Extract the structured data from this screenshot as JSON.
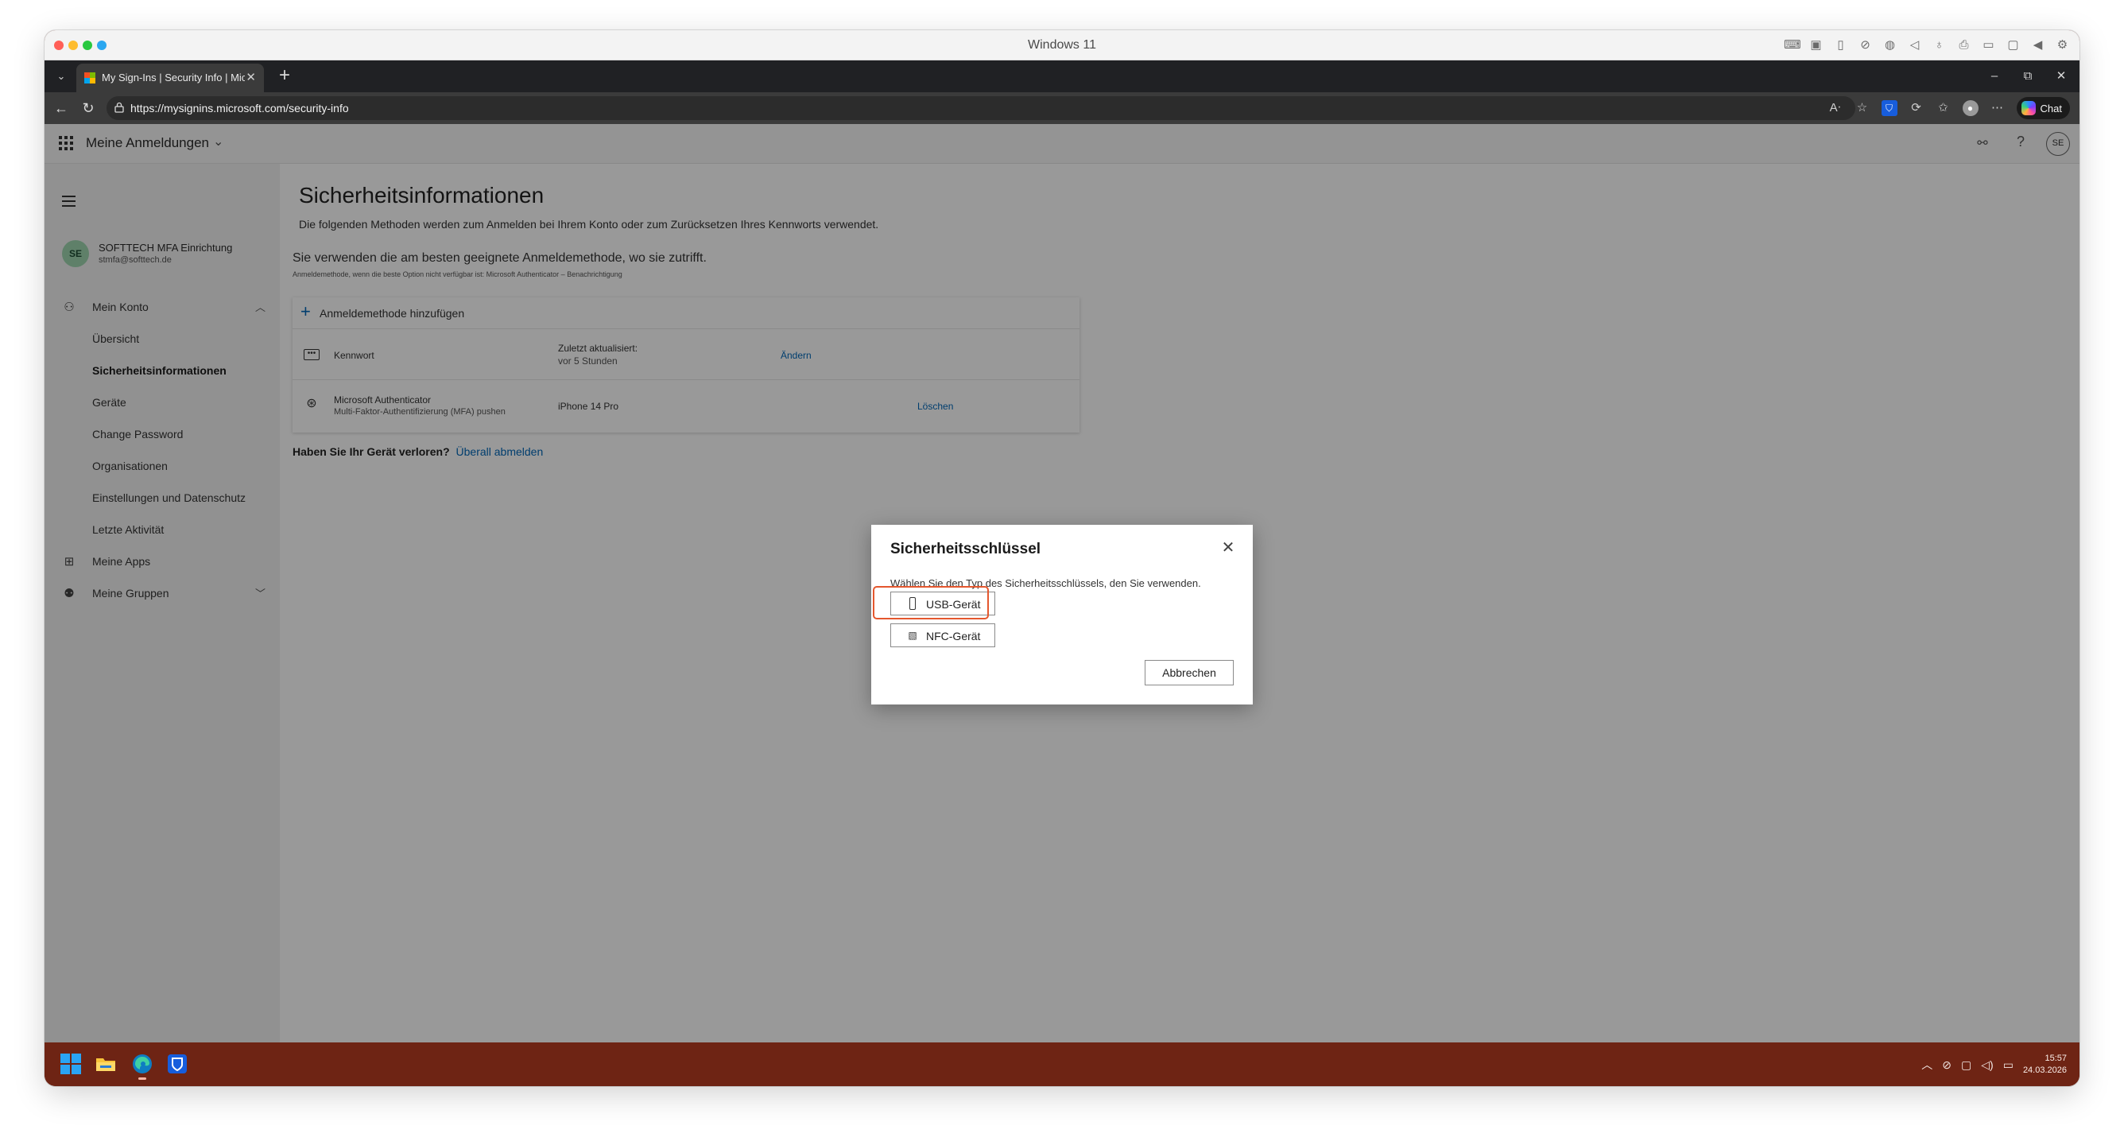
{
  "mac": {
    "window_title": "Windows 11",
    "traffic_colors": [
      "#ff5f57",
      "#febc2e",
      "#28c840",
      "#2aa7f0"
    ],
    "toolbar_icons": [
      "keyboard-icon",
      "cpu-icon",
      "usb-icon",
      "camera-off-icon",
      "globe-icon",
      "speaker-icon",
      "microphone-icon",
      "printer-icon",
      "video-icon",
      "display-icon",
      "play-icon",
      "settings-icon"
    ]
  },
  "browser": {
    "tab_title": "My Sign-Ins | Security Info | Microsoft",
    "url": "https://mysignins.microsoft.com/security-info",
    "chat_label": "Chat"
  },
  "app": {
    "title": "Meine Anmeldungen",
    "avatar_initials": "SE"
  },
  "sidebar": {
    "profile_initials": "SE",
    "profile_name": "SOFTTECH MFA Einrichtung",
    "profile_email": "stmfa@softtech.de",
    "items": [
      {
        "label": "Mein Konto"
      },
      {
        "label": "Übersicht"
      },
      {
        "label": "Sicherheitsinformationen"
      },
      {
        "label": "Geräte"
      },
      {
        "label": "Change Password"
      },
      {
        "label": "Organisationen"
      },
      {
        "label": "Einstellungen und Datenschutz"
      },
      {
        "label": "Letzte Aktivität"
      },
      {
        "label": "Meine Apps"
      },
      {
        "label": "Meine Gruppen"
      }
    ]
  },
  "main": {
    "title": "Sicherheitsinformationen",
    "description": "Die folgenden Methoden werden zum Anmelden bei Ihrem Konto oder zum Zurücksetzen Ihres Kennworts verwendet.",
    "default_method": "Sie verwenden die am besten geeignete Anmeldemethode, wo sie zutrifft.",
    "default_method_sub": "Anmeldemethode, wenn die beste Option nicht verfügbar ist: Microsoft Authenticator – Benachrichtigung",
    "add_method": "Anmeldemethode hinzufügen",
    "methods": [
      {
        "name": "Kennwort",
        "subtitle": "",
        "detail_label": "Zuletzt aktualisiert:",
        "detail_value": "vor 5 Stunden",
        "action": "Ändern"
      },
      {
        "name": "Microsoft Authenticator",
        "subtitle": "Multi-Faktor-Authentifizierung (MFA) pushen",
        "detail_label": "iPhone 14 Pro",
        "detail_value": "",
        "action": "Löschen"
      }
    ],
    "lost_device_question": "Haben Sie Ihr Gerät verloren?",
    "lost_device_link": "Überall abmelden"
  },
  "dialog": {
    "title": "Sicherheitsschlüssel",
    "text": "Wählen Sie den Typ des Sicherheitsschlüssels, den Sie verwenden.",
    "usb_label": "USB-Gerät",
    "nfc_label": "NFC-Gerät",
    "cancel_label": "Abbrechen",
    "highlight_color": "#e4572e"
  },
  "taskbar": {
    "time": "15:57",
    "date": "24.03.2026",
    "background": "#6e2414"
  }
}
